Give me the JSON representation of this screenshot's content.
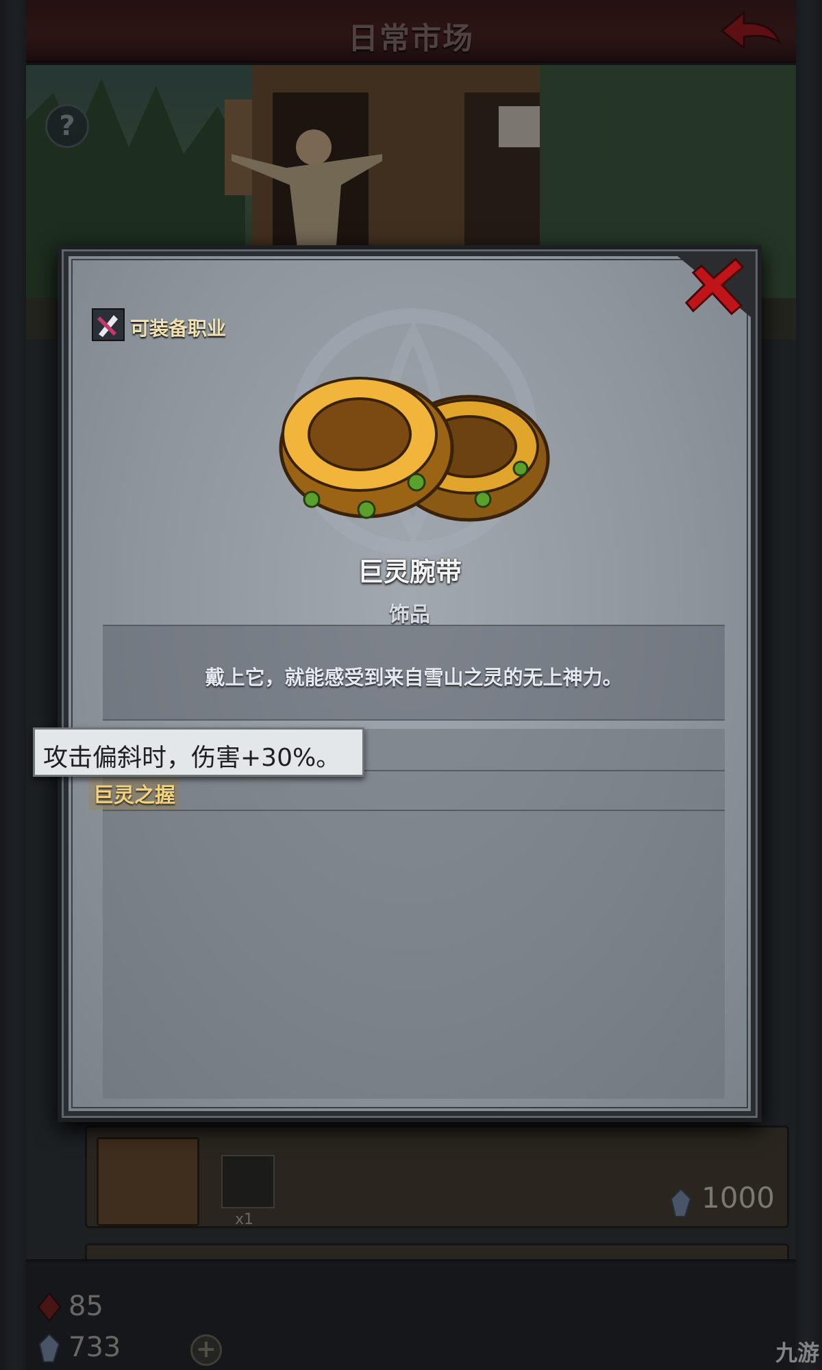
{
  "header": {
    "title": "日常市场"
  },
  "shop": {
    "card": {
      "quantity": "x1",
      "price": "1000"
    }
  },
  "resources": {
    "red_gem": "85",
    "blue_crystal": "733"
  },
  "watermark": "九游",
  "modal": {
    "class_label": "可装备职业",
    "item_name": "巨灵腕带",
    "item_type": "饰品",
    "description": "戴上它，就能感受到来自雪山之灵的无上神力。",
    "skill_name": "巨灵之握",
    "tooltip": "攻击偏斜时，伤害+30%。"
  },
  "colors": {
    "accent_gold": "#f2d27a",
    "close_red": "#c0141b",
    "header_bg": "#4b1d1a"
  },
  "icons": [
    "back-arrow-icon",
    "help-icon",
    "close-icon",
    "class-icon",
    "red-gem-icon",
    "blue-crystal-icon",
    "add-icon"
  ]
}
